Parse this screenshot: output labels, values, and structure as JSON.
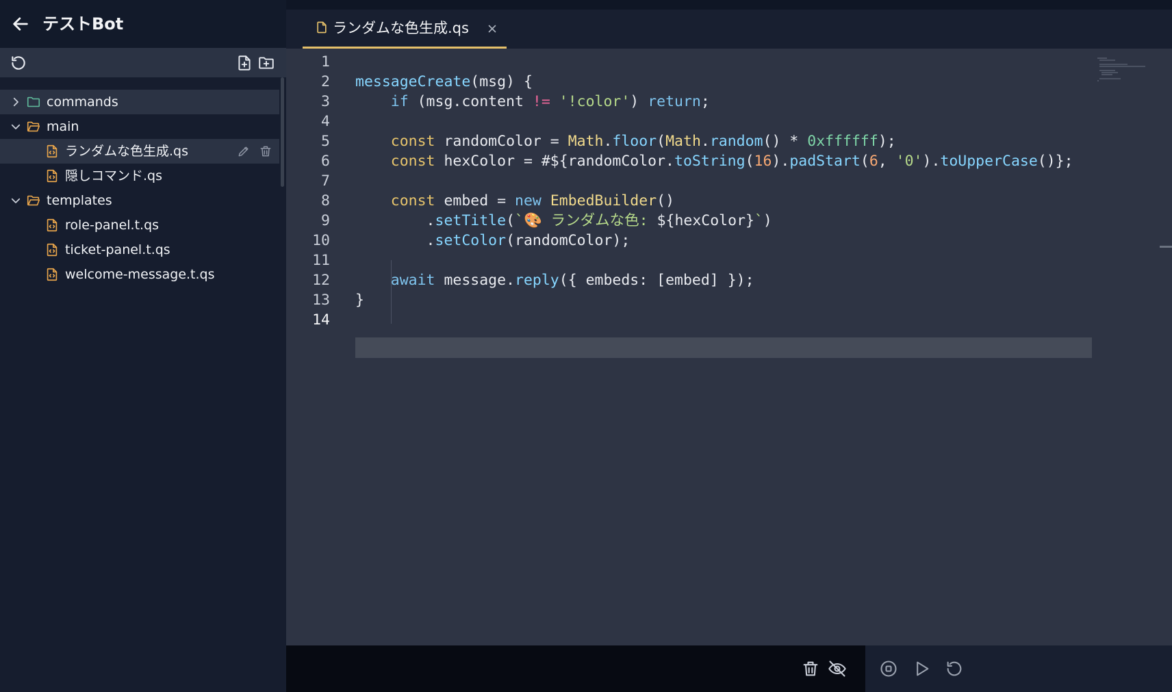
{
  "header": {
    "title": "テストBot"
  },
  "toolbar": {
    "refresh_icon": "refresh-icon",
    "new_file_icon": "new-file-icon",
    "new_folder_icon": "new-folder-icon"
  },
  "tree": [
    {
      "type": "folder",
      "label": "commands",
      "expanded": false
    },
    {
      "type": "folder",
      "label": "main",
      "expanded": true
    },
    {
      "type": "file",
      "label": "ランダムな色生成.qs",
      "selected": true
    },
    {
      "type": "file",
      "label": "隠しコマンド.qs"
    },
    {
      "type": "folder",
      "label": "templates",
      "expanded": true
    },
    {
      "type": "file",
      "label": "role-panel.t.qs"
    },
    {
      "type": "file",
      "label": "ticket-panel.t.qs"
    },
    {
      "type": "file",
      "label": "welcome-message.t.qs"
    }
  ],
  "editor": {
    "tab_label": "ランダムな色生成.qs",
    "current_line": 14,
    "line_numbers": [
      "1",
      "2",
      "3",
      "4",
      "5",
      "6",
      "7",
      "8",
      "9",
      "10",
      "11",
      "12",
      "13",
      "14"
    ],
    "code_lines": [
      "",
      "messageCreate(msg) {",
      "    if (msg.content != '!color') return;",
      "",
      "    const randomColor = Math.floor(Math.random() * 0xffffff);",
      "    const hexColor = #${randomColor.toString(16).padStart(6, '0').toUpperCase()};",
      "",
      "    const embed = new EmbedBuilder()",
      "        .setTitle(`🎨 ランダムな色: ${hexColor}`)",
      "        .setColor(randomColor);",
      "",
      "    await message.reply({ embeds: [embed] });",
      "}",
      ""
    ]
  },
  "colors": {
    "accent": "#e5c06a",
    "folder": "#5fb89a",
    "file": "#e8a54b",
    "sidebar_bg": "#161d2e",
    "editor_bg": "#2e3444"
  }
}
